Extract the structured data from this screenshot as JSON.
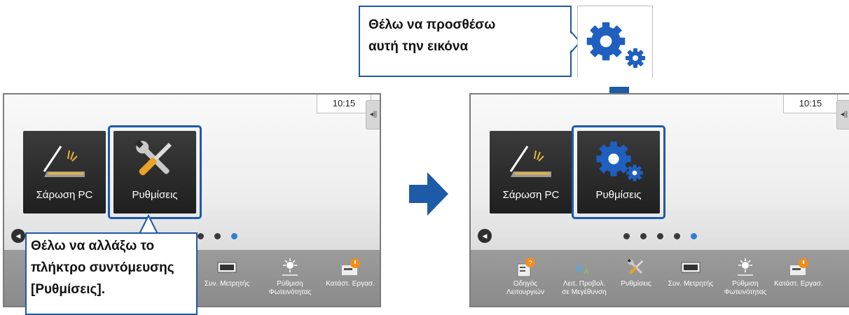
{
  "top_callout": {
    "text": "Θέλω να προσθέσω\nαυτή την εικόνα"
  },
  "bottom_callout": {
    "text": "Θέλω να αλλάξω το\nπλήκτρο συντόμευσης\n[Ρυθμίσεις]."
  },
  "left_screen": {
    "time": "10:15",
    "tiles": [
      {
        "label": "Σάρωση PC"
      },
      {
        "label": "Ρυθμίσεις"
      }
    ],
    "dock": [
      {
        "label": "Συν. Μετρητής"
      },
      {
        "label": "Ρύθμιση\nΦωτεινότητας"
      },
      {
        "label": "Κατάστ. Εργασ."
      }
    ]
  },
  "right_screen": {
    "time": "10:15",
    "tiles": [
      {
        "label": "Σάρωση PC"
      },
      {
        "label": "Ρυθμίσεις"
      }
    ],
    "dock": [
      {
        "label": "Οδηγός\nΛειτουργιών"
      },
      {
        "label": "Λειτ. Προβολ.\nσε Μεγέθυνση"
      },
      {
        "label": "Ρυθμίσεις"
      },
      {
        "label": "Συν. Μετρητής"
      },
      {
        "label": "Ρύθμιση\nΦωτεινότητας"
      },
      {
        "label": "Κατάστ. Εργασ."
      }
    ]
  },
  "colors": {
    "accent": "#1d5aa8",
    "active_dot": "#2f7fd0",
    "gear": "#1f5fbf"
  },
  "icons": [
    "gears-icon",
    "scanner-icon",
    "wrench-screwdriver-icon",
    "counter-icon",
    "brightness-icon",
    "job-status-icon",
    "guide-icon",
    "magnify-mode-icon",
    "arrow-right-icon",
    "arrow-down-icon",
    "triangle-left-icon"
  ]
}
